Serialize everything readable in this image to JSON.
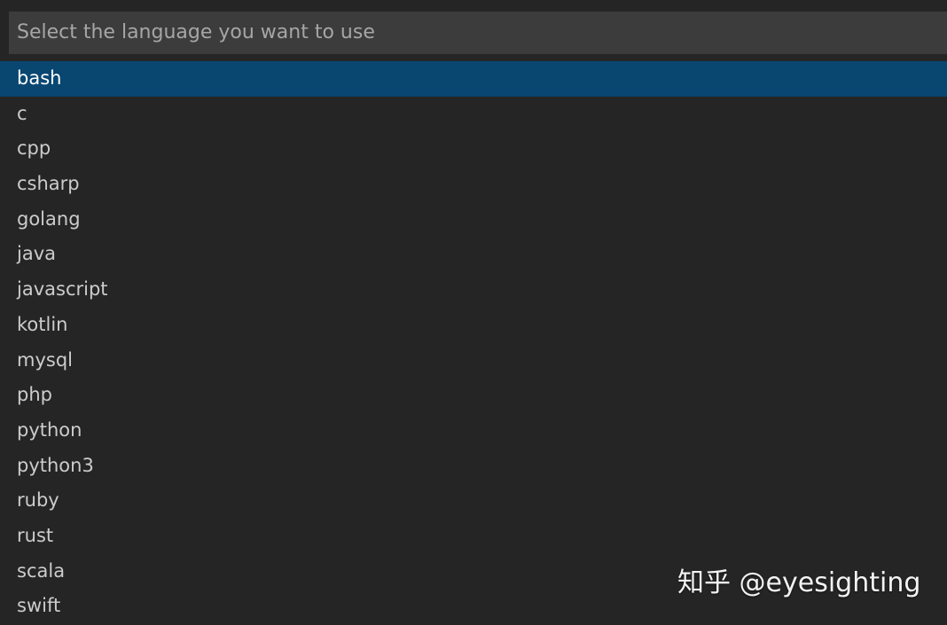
{
  "quick_pick": {
    "placeholder": "Select the language you want to use",
    "value": "",
    "selected_index": 0,
    "items": [
      {
        "label": "bash"
      },
      {
        "label": "c"
      },
      {
        "label": "cpp"
      },
      {
        "label": "csharp"
      },
      {
        "label": "golang"
      },
      {
        "label": "java"
      },
      {
        "label": "javascript"
      },
      {
        "label": "kotlin"
      },
      {
        "label": "mysql"
      },
      {
        "label": "php"
      },
      {
        "label": "python"
      },
      {
        "label": "python3"
      },
      {
        "label": "ruby"
      },
      {
        "label": "rust"
      },
      {
        "label": "scala"
      },
      {
        "label": "swift"
      }
    ]
  },
  "watermark": {
    "text": "知乎 @eyesighting"
  },
  "colors": {
    "background": "#252526",
    "input_background": "#3c3c3c",
    "selection": "#094771",
    "text": "#cccccc"
  }
}
